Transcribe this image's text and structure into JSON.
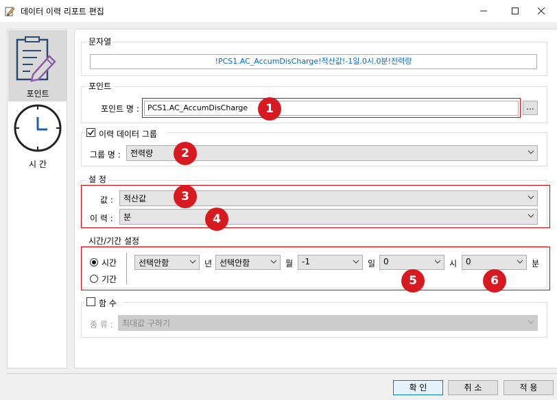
{
  "window": {
    "title": "데이터 이력 리포트 편집"
  },
  "nav": {
    "items": [
      {
        "label": "포인트",
        "icon": "document-edit-icon"
      },
      {
        "label": "시 간",
        "icon": "clock-icon"
      }
    ]
  },
  "string_section": {
    "label": "문자열",
    "value": "!PCS1.AC_AccumDisCharge!적산값!-1일.0시.0분!전력량"
  },
  "point_section": {
    "label": "포인트",
    "name_label": "포인트 명 :",
    "name_value": "PCS1.AC_AccumDisCharge",
    "browse": "..."
  },
  "history_group": {
    "checkbox_label": "이력 데이터 그룹",
    "checked": true,
    "name_label": "그룹 명 :",
    "name_value": "전력량"
  },
  "settings": {
    "label": "설 정",
    "value_label": "값 :",
    "value": "적산값",
    "history_label": "이 력 :",
    "history_value": "분"
  },
  "time_settings": {
    "label": "시간/기간 설정",
    "radio_time": "시간",
    "radio_period": "기간",
    "selected": "시간",
    "year_value": "선택안함",
    "year_unit": "년",
    "month_value": "선택안함",
    "month_unit": "월",
    "day_value": "-1",
    "day_unit": "일",
    "hour_value": "0",
    "hour_unit": "시",
    "minute_value": "0",
    "minute_unit": "분"
  },
  "function_group": {
    "checkbox_label": "함 수",
    "checked": false,
    "type_label": "종 류 :",
    "type_value": "최대값 구하기"
  },
  "badges": [
    "1",
    "2",
    "3",
    "4",
    "5",
    "6"
  ],
  "buttons": {
    "ok": "확 인",
    "cancel": "취 소",
    "apply": "적 용"
  },
  "colors": {
    "accent_blue": "#0067c0",
    "badge_red": "#d71920",
    "highlight_red": "#e00000"
  }
}
